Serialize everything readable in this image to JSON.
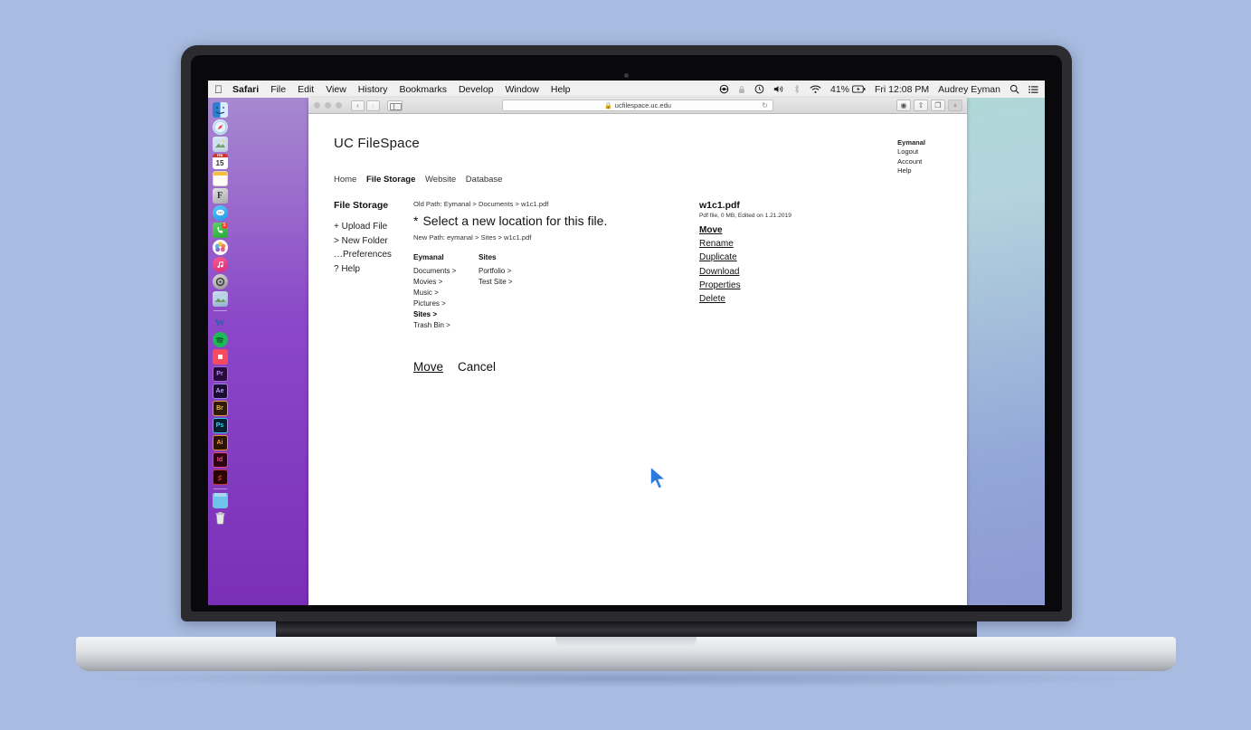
{
  "menubar": {
    "apple_icon": "apple-icon",
    "items": [
      "Safari",
      "File",
      "Edit",
      "View",
      "History",
      "Bookmarks",
      "Develop",
      "Window",
      "Help"
    ],
    "active_app": "Safari",
    "status": {
      "dropbox_icon": "dropbox-icon",
      "lock_icon": "lock-icon",
      "time-machine_icon": "clock-icon",
      "volume_icon": "volume-icon",
      "bluetooth_icon": "bluetooth-icon",
      "wifi_icon": "wifi-icon",
      "battery": "41%",
      "battery_icon": "battery-charging-icon",
      "datetime": "Fri 12:08 PM",
      "user": "Audrey Eyman",
      "search_icon": "search-icon",
      "notification_icon": "notification-center-icon"
    }
  },
  "browser": {
    "url": "ucfilespace.uc.edu",
    "lock_icon": "lock-icon",
    "reload_icon": "reload-icon",
    "back_icon": "chevron-left-icon",
    "forward_icon": "chevron-right-icon",
    "sidebar_icon": "sidebar-icon",
    "toolbar_buttons": [
      "settings-icon",
      "share-icon",
      "tabs-icon"
    ],
    "new_tab_label": "+"
  },
  "page": {
    "brand": "UC FileSpace",
    "account": {
      "username": "Eymanal",
      "links": [
        "Logout",
        "Account",
        "Help"
      ]
    },
    "nav": [
      {
        "label": "Home",
        "active": false
      },
      {
        "label": "File Storage",
        "active": true
      },
      {
        "label": "Website",
        "active": false
      },
      {
        "label": "Database",
        "active": false
      }
    ],
    "sidebar": {
      "title": "File Storage",
      "items": [
        "+ Upload File",
        "> New Folder",
        "…Preferences",
        "? Help"
      ]
    },
    "move_panel": {
      "old_path": "Old Path: Eymanal > Documents > w1c1.pdf",
      "prompt_marker": "*",
      "prompt": "Select a new location for this file.",
      "new_path": "New Path: eymanal > Sites > w1c1.pdf",
      "columns": [
        {
          "header": "Eymanal",
          "items": [
            {
              "label": "Documents >",
              "selected": false
            },
            {
              "label": "Movies >",
              "selected": false
            },
            {
              "label": "Music >",
              "selected": false
            },
            {
              "label": "Pictures >",
              "selected": false
            },
            {
              "label": "Sites >",
              "selected": true
            },
            {
              "label": "Trash Bin >",
              "selected": false
            }
          ]
        },
        {
          "header": "Sites",
          "items": [
            {
              "label": "Portfolio >",
              "selected": false
            },
            {
              "label": "Test Site >",
              "selected": false
            }
          ]
        }
      ],
      "confirm_label": "Move",
      "cancel_label": "Cancel"
    },
    "file_details": {
      "name": "w1c1.pdf",
      "meta": "Pdf file, 0 MB, Edited on 1.21.2019",
      "operations": [
        {
          "label": "Move",
          "active": true
        },
        {
          "label": "Rename",
          "active": false
        },
        {
          "label": "Duplicate",
          "active": false
        },
        {
          "label": "Download",
          "active": false
        },
        {
          "label": "Properties",
          "active": false
        },
        {
          "label": "Delete",
          "active": false
        }
      ]
    }
  },
  "dock": {
    "items": [
      {
        "name": "finder-icon",
        "label": ""
      },
      {
        "name": "safari-icon",
        "label": ""
      },
      {
        "name": "preview-icon",
        "label": ""
      },
      {
        "name": "calendar-icon",
        "label": "15"
      },
      {
        "name": "notes-icon",
        "label": ""
      },
      {
        "name": "font-book-icon",
        "label": "F"
      },
      {
        "name": "messages-icon",
        "label": ""
      },
      {
        "name": "facetime-icon",
        "label": "",
        "badge": "1"
      },
      {
        "name": "photos-icon",
        "label": ""
      },
      {
        "name": "music-icon",
        "label": ""
      },
      {
        "name": "system-preferences-icon",
        "label": ""
      },
      {
        "name": "image-capture-icon",
        "label": ""
      },
      {
        "name": "word-icon",
        "label": "W"
      },
      {
        "name": "spotify-icon",
        "label": ""
      },
      {
        "name": "record-app-icon",
        "label": ""
      },
      {
        "name": "premiere-pro-icon",
        "label": "Pr"
      },
      {
        "name": "after-effects-icon",
        "label": "Ae"
      },
      {
        "name": "bridge-icon",
        "label": "Br"
      },
      {
        "name": "photoshop-icon",
        "label": "Ps"
      },
      {
        "name": "illustrator-icon",
        "label": "Ai"
      },
      {
        "name": "indesign-icon",
        "label": "Id"
      },
      {
        "name": "acrobat-icon",
        "label": ""
      },
      {
        "name": "downloads-stack-icon",
        "label": ""
      },
      {
        "name": "trash-icon",
        "label": ""
      }
    ]
  },
  "colors": {
    "desktop_background": "#a8bbe0",
    "wallpaper_left": "#8b48c8",
    "wallpaper_right_top": "#a9dfd0",
    "wallpaper_right_bottom": "#8d9ad4",
    "cursor": "#2a7ade"
  }
}
